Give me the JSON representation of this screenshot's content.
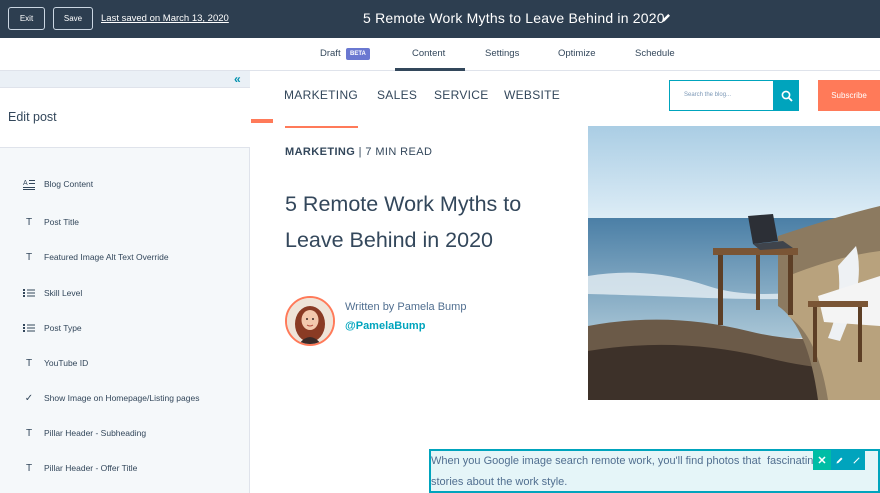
{
  "topbar": {
    "exit_label": "Exit",
    "save_label": "Save",
    "last_saved": "Last saved on March 13, 2020",
    "post_title": "5 Remote Work Myths to Leave Behind in 2020",
    "edit_icon": "pencil-icon"
  },
  "tabs": {
    "draft": "Draft",
    "beta": "BETA",
    "content": "Content",
    "settings": "Settings",
    "optimize": "Optimize",
    "schedule": "Schedule",
    "active": "Content"
  },
  "sidebar": {
    "collapse_icon": "double-chevron-left-icon",
    "heading": "Edit post",
    "items": [
      {
        "label": "Blog Content",
        "icon": "rich-text-icon"
      },
      {
        "label": "Post Title",
        "icon": "text-icon"
      },
      {
        "label": "Featured Image Alt Text Override",
        "icon": "text-icon"
      },
      {
        "label": "Skill Level",
        "icon": "list-icon"
      },
      {
        "label": "Post Type",
        "icon": "list-icon"
      },
      {
        "label": "YouTube ID",
        "icon": "text-icon"
      },
      {
        "label": "Show Image on Homepage/Listing pages",
        "icon": "checkmark-icon"
      },
      {
        "label": "Pillar Header - Subheading",
        "icon": "text-icon"
      },
      {
        "label": "Pillar Header - Offer Title",
        "icon": "text-icon"
      }
    ]
  },
  "site": {
    "nav": [
      "MARKETING",
      "SALES",
      "SERVICE",
      "WEBSITE"
    ],
    "search_placeholder": "Search the blog...",
    "subscribe_label": "Subscribe"
  },
  "article": {
    "category": "MARKETING",
    "read_time": " | 7 MIN READ",
    "title": "5 Remote Work Myths to Leave Behind in 2020",
    "written_by": "Written by Pamela Bump",
    "handle": "@PamelaBump",
    "body": "When you Google image search remote work, you'll find photos that  fascinating stories about the work style."
  },
  "colors": {
    "topbar": "#2d3e50",
    "accent": "#00a4bd",
    "orange": "#ff7a59",
    "text": "#33475b"
  }
}
